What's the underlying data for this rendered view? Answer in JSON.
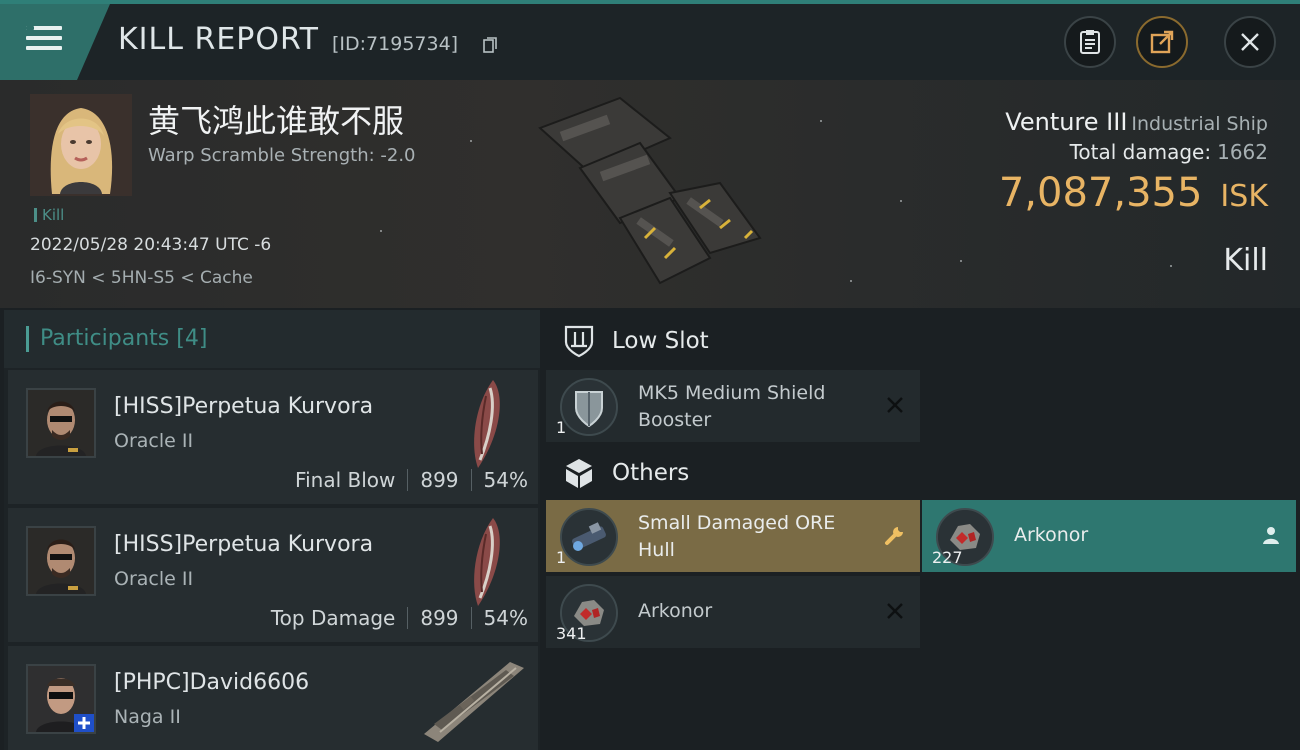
{
  "header": {
    "title": "KILL REPORT",
    "report_id": "[ID:7195734]"
  },
  "victim": {
    "name": "黄飞鸿此谁敢不服",
    "warp_scramble": "Warp Scramble Strength: -2.0",
    "tag": "Kill",
    "datetime": "2022/05/28 20:43:47 UTC -6",
    "location": "I6-SYN < 5HN-S5 < Cache"
  },
  "ship": {
    "name": "Venture III",
    "class": "Industrial Ship",
    "total_damage_label": "Total damage:",
    "total_damage": "1662",
    "isk_value": "7,087,355",
    "isk_unit": "ISK",
    "result": "Kill"
  },
  "participants": {
    "title": "Participants",
    "count": "[4]",
    "rows": [
      {
        "name": "[HISS]Perpetua Kurvora",
        "ship": "Oracle II",
        "role": "Final Blow",
        "damage": "899",
        "percent": "54%"
      },
      {
        "name": "[HISS]Perpetua Kurvora",
        "ship": "Oracle II",
        "role": "Top Damage",
        "damage": "899",
        "percent": "54%"
      },
      {
        "name": "[PHPC]David6606",
        "ship": "Naga II"
      }
    ]
  },
  "low_slot": {
    "title": "Low Slot",
    "items": [
      {
        "qty": "1",
        "name_line1": "MK5 Medium Shield",
        "name_line2": "Booster",
        "status": "destroyed"
      }
    ]
  },
  "others": {
    "title": "Others",
    "items": [
      {
        "qty": "1",
        "name_line1": "Small Damaged ORE",
        "name_line2": "Hull",
        "status": "salvage",
        "color": "#7a6b45"
      },
      {
        "qty": "227",
        "name": "Arkonor",
        "status": "dropped",
        "color": "#2e7770"
      },
      {
        "qty": "341",
        "name": "Arkonor",
        "status": "destroyed"
      }
    ]
  },
  "colors": {
    "accent_teal": "#2e6f69",
    "isk_gold": "#e8b464",
    "dropped": "#2e7770",
    "salvage": "#7a6b45"
  },
  "icons": [
    "menu-icon",
    "copy-icon",
    "clipboard-icon",
    "share-icon",
    "close-icon",
    "shield-slot-icon",
    "cube-icon",
    "close-x-icon",
    "wrench-icon",
    "person-icon"
  ]
}
